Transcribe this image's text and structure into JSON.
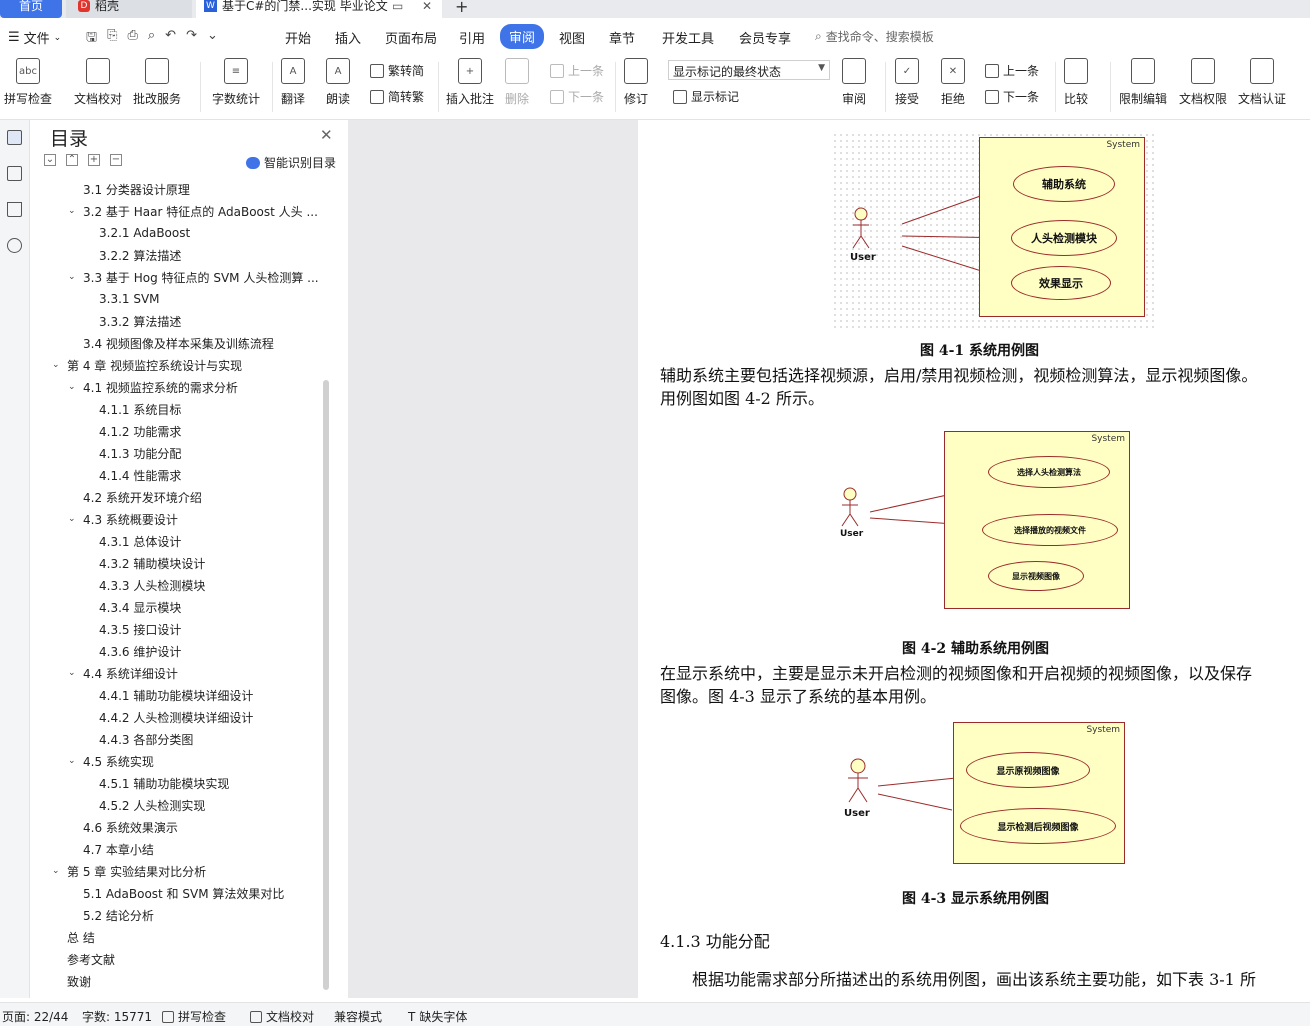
{
  "tabs": {
    "home": "首页",
    "daoke": "稻壳",
    "doc": "基于C#的门禁...实现 毕业论文"
  },
  "menu": {
    "file": "文件",
    "items": [
      "开始",
      "插入",
      "页面布局",
      "引用",
      "审阅",
      "视图",
      "章节",
      "开发工具",
      "会员专享"
    ],
    "active": "审阅",
    "search": "查找命令、搜索模板"
  },
  "ribbon": {
    "spell": "拼写检查",
    "proof": "文档校对",
    "annotate_service": "批改服务",
    "word_count": "字数统计",
    "translate": "翻译",
    "read_aloud": "朗读",
    "trad_convert": "繁转简",
    "simp_convert": "简转繁",
    "insert_comment": "插入批注",
    "delete": "删除",
    "prev": "上一条",
    "next": "下一条",
    "revise": "修订",
    "markup_select": "显示标记的最终状态",
    "show_markup": "显示标记",
    "review": "审阅",
    "accept": "接受",
    "reject": "拒绝",
    "prev2": "上一条",
    "next2": "下一条",
    "compare": "比较",
    "restrict_edit": "限制编辑",
    "doc_permission": "文档权限",
    "doc_auth": "文档认证"
  },
  "toc": {
    "title": "目录",
    "smart": "智能识别目录",
    "items": [
      {
        "text": "3.1  分类器设计原理",
        "level": 2,
        "chev": false
      },
      {
        "text": "3.2  基于 Haar 特征点的 AdaBoost 人头 ...",
        "level": 2,
        "chev": true
      },
      {
        "text": "3.2.1 AdaBoost",
        "level": 3,
        "chev": false
      },
      {
        "text": "3.2.2  算法描述",
        "level": 3,
        "chev": false
      },
      {
        "text": "3.3  基于 Hog 特征点的 SVM 人头检测算 ...",
        "level": 2,
        "chev": true
      },
      {
        "text": "3.3.1 SVM",
        "level": 3,
        "chev": false
      },
      {
        "text": "3.3.2  算法描述",
        "level": 3,
        "chev": false
      },
      {
        "text": "3.4  视频图像及样本采集及训练流程",
        "level": 2,
        "chev": false
      },
      {
        "text": "第 4 章    视频监控系统设计与实现",
        "level": 1,
        "chev": true
      },
      {
        "text": "4.1    视频监控系统的需求分析",
        "level": 2,
        "chev": true
      },
      {
        "text": "4.1.1  系统目标",
        "level": 3,
        "chev": false
      },
      {
        "text": "4.1.2  功能需求",
        "level": 3,
        "chev": false
      },
      {
        "text": "4.1.3  功能分配",
        "level": 3,
        "chev": false
      },
      {
        "text": "4.1.4  性能需求",
        "level": 3,
        "chev": false
      },
      {
        "text": "4.2  系统开发环境介绍",
        "level": 2,
        "chev": false
      },
      {
        "text": "4.3 系统概要设计",
        "level": 2,
        "chev": true
      },
      {
        "text": "4.3.1  总体设计",
        "level": 3,
        "chev": false
      },
      {
        "text": "4.3.2  辅助模块设计",
        "level": 3,
        "chev": false
      },
      {
        "text": "4.3.3  人头检测模块",
        "level": 3,
        "chev": false
      },
      {
        "text": "4.3.4  显示模块",
        "level": 3,
        "chev": false
      },
      {
        "text": "4.3.5  接口设计",
        "level": 3,
        "chev": false
      },
      {
        "text": "4.3.6 维护设计",
        "level": 3,
        "chev": false
      },
      {
        "text": "4.4  系统详细设计",
        "level": 2,
        "chev": true
      },
      {
        "text": "4.4.1  辅助功能模块详细设计",
        "level": 3,
        "chev": false
      },
      {
        "text": "4.4.2  人头检测模块详细设计",
        "level": 3,
        "chev": false
      },
      {
        "text": "4.4.3  各部分类图",
        "level": 3,
        "chev": false
      },
      {
        "text": "4.5  系统实现",
        "level": 2,
        "chev": true
      },
      {
        "text": "4.5.1  辅助功能模块实现",
        "level": 3,
        "chev": false
      },
      {
        "text": "4.5.2 人头检测实现",
        "level": 3,
        "chev": false
      },
      {
        "text": "4.6  系统效果演示",
        "level": 2,
        "chev": false
      },
      {
        "text": "4.7 本章小结",
        "level": 2,
        "chev": false
      },
      {
        "text": "第 5 章    实验结果对比分析",
        "level": 1,
        "chev": true
      },
      {
        "text": "5.1 AdaBoost 和 SVM 算法效果对比",
        "level": 2,
        "chev": false
      },
      {
        "text": "5.2 结论分析",
        "level": 2,
        "chev": false
      },
      {
        "text": "总  结",
        "level": 1,
        "chev": false
      },
      {
        "text": "参考文献",
        "level": 1,
        "chev": false
      },
      {
        "text": "致谢",
        "level": 1,
        "chev": false
      }
    ]
  },
  "document": {
    "fig1": {
      "system": "System",
      "actor": "User",
      "usecases": [
        "辅助系统",
        "人头检测模块",
        "效果显示"
      ],
      "caption": "图 4-1  系统用例图"
    },
    "para1_line1": "辅助系统主要包括选择视频源，启用/禁用视频检测，视频检测算法，显示视频图像。",
    "para1_line2": "用例图如图 4-2 所示。",
    "fig2": {
      "system": "System",
      "actor": "User",
      "usecases": [
        "选择人头检测算法",
        "选择播放的视频文件",
        "显示视频图像"
      ],
      "caption": "图 4-2    辅助系统用例图"
    },
    "para2_line1": "在显示系统中，主要是显示未开启检测的视频图像和开启视频的视频图像，以及保存",
    "para2_line2": "图像。图 4-3 显示了系统的基本用例。",
    "fig3": {
      "system": "System",
      "actor": "User",
      "usecases": [
        "显示原视频图像",
        "显示检测后视频图像"
      ],
      "caption": "图 4-3    显示系统用例图"
    },
    "heading": "4.1.3  功能分配",
    "para3": "根据功能需求部分所描述出的系统用例图，画出该系统主要功能，如下表 3-1 所"
  },
  "status": {
    "page": "页面: 22/44",
    "words": "字数: 15771",
    "spell": "拼写检查",
    "proof": "文档校对",
    "compat": "兼容模式",
    "missing_font": "缺失字体"
  }
}
